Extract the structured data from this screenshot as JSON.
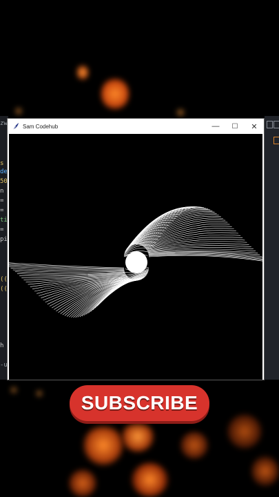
{
  "window": {
    "title": "Sam Codehub",
    "icon": "feather-icon",
    "controls": {
      "minimize": "—",
      "maximize": "☐",
      "close": "✕"
    }
  },
  "drawing": {
    "description_color": "#ffffff",
    "background_color": "#000000"
  },
  "editor_left": {
    "lines": [
      {
        "text": "zw",
        "color": "#9aa0a6"
      },
      {
        "text": "s",
        "color": "#e0c060"
      },
      {
        "text": "de",
        "color": "#5ab0ff"
      },
      {
        "text": "50,",
        "color": "#e0c060"
      },
      {
        "text": "n",
        "color": "#c8c8c8"
      },
      {
        "text": "=",
        "color": "#c8c8c8"
      },
      {
        "text": "=",
        "color": "#c8c8c8"
      },
      {
        "text": "ti",
        "color": "#7ec97e"
      },
      {
        "text": "=",
        "color": "#c8c8c8"
      },
      {
        "text": "pi",
        "color": "#c8c8c8"
      },
      {
        "text": "((",
        "color": "#e0c060"
      },
      {
        "text": "((",
        "color": "#e0c060"
      },
      {
        "text": "h",
        "color": "#c8c8c8"
      },
      {
        "text": "-u",
        "color": "#9aa0a6"
      }
    ]
  },
  "subscribe": {
    "label": "SUBSCRIBE",
    "color": "#d7332c"
  }
}
